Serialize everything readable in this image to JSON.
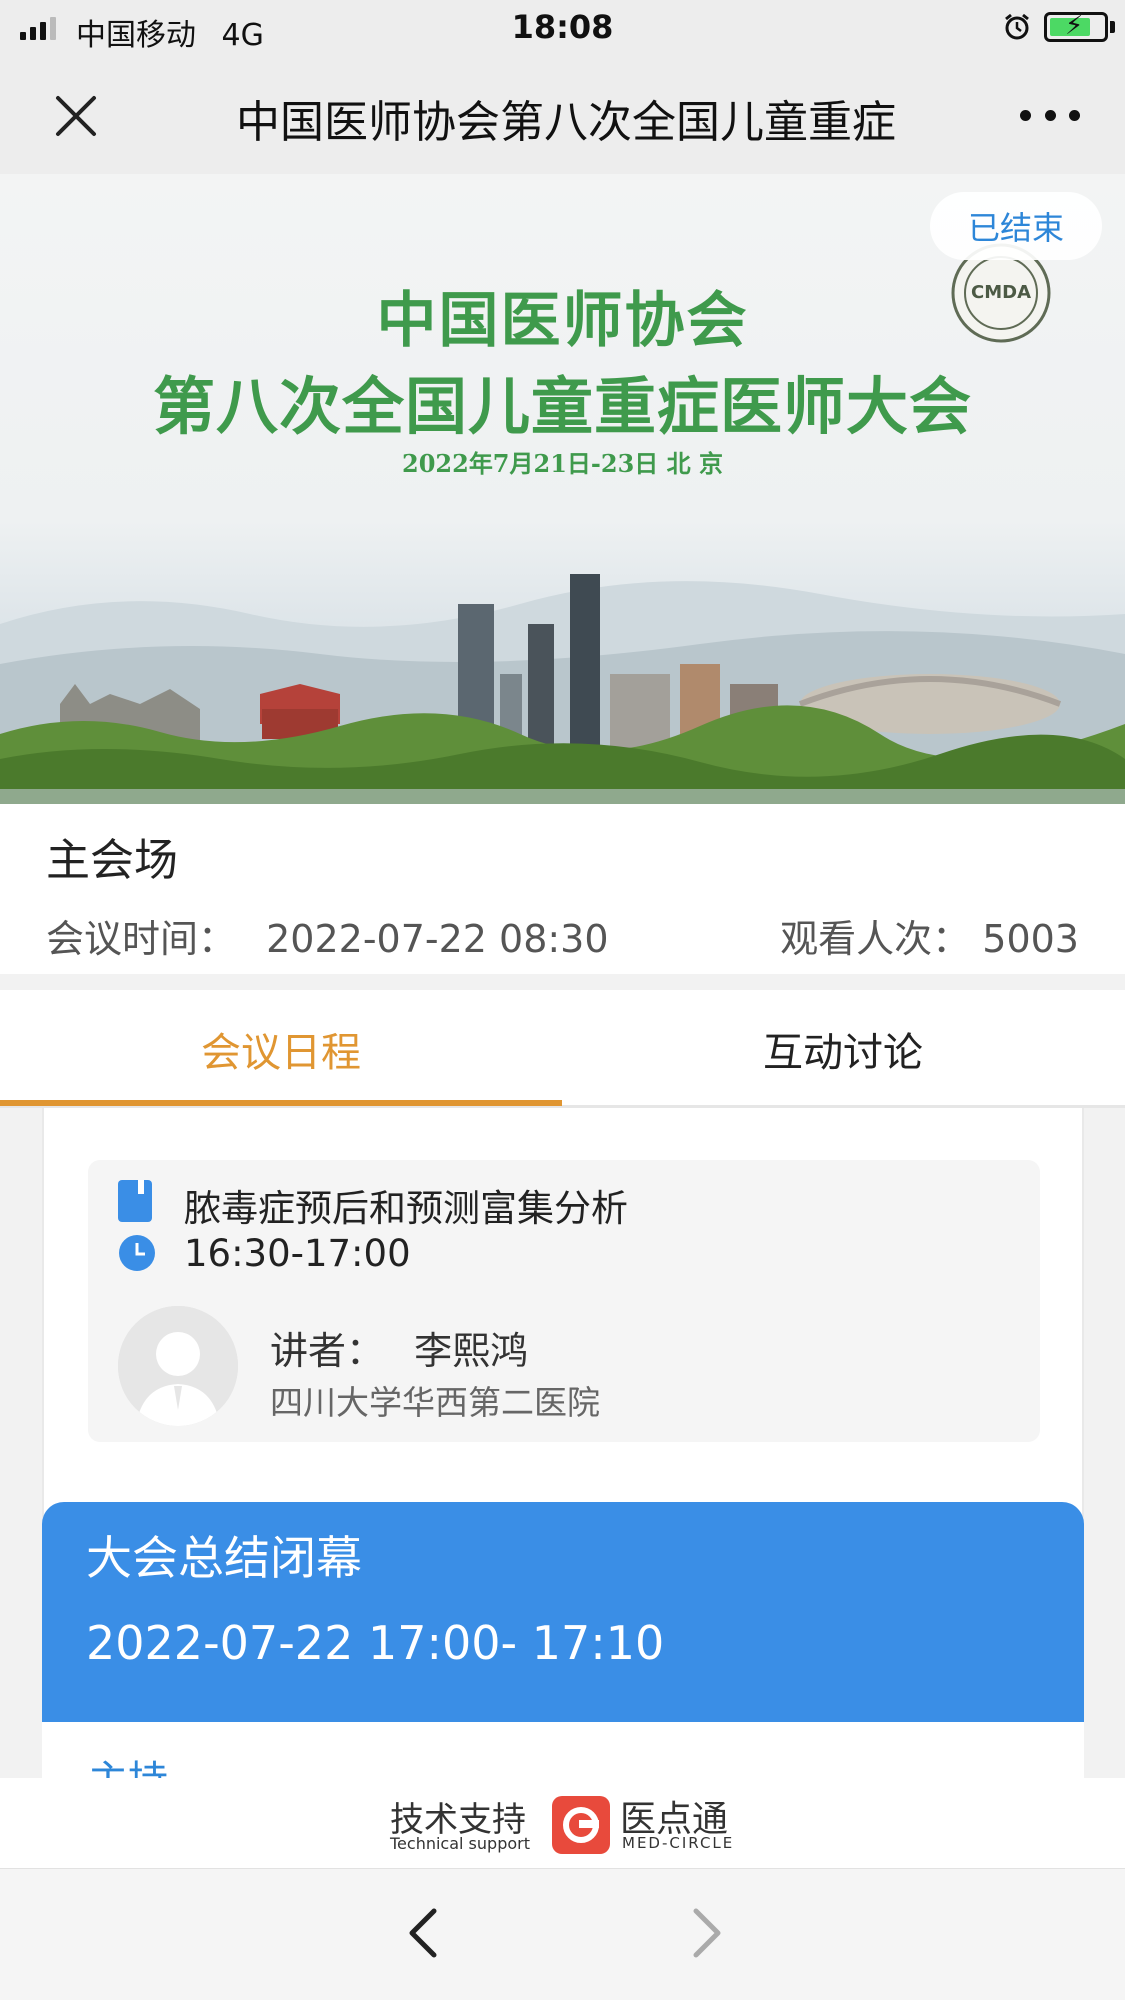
{
  "status_bar": {
    "carrier": "中国移动",
    "network": "4G",
    "time": "18:08",
    "battery_state": "charging"
  },
  "nav": {
    "title": "中国医师协会第八次全国儿童重症",
    "close_icon": "close-icon",
    "more_icon": "more-icon"
  },
  "banner": {
    "status_badge": "已结束",
    "title_line1": "中国医师协会",
    "title_line2": "第八次全国儿童重症医师大会",
    "date_location": "2022年7月21日-23日   北 京",
    "logo_text": "CMDA"
  },
  "info": {
    "hall": "主会场",
    "time_label": "会议时间：",
    "time_value": "2022-07-22 08:30",
    "views_label": "观看人次：",
    "views_value": "5003"
  },
  "tabs": [
    {
      "label": "会议日程",
      "active": true
    },
    {
      "label": "互动讨论",
      "active": false
    }
  ],
  "schedule_item": {
    "title": "脓毒症预后和预测富集分析",
    "time": "16:30-17:00",
    "speaker_label": "讲者：",
    "speaker_name": "李熙鸿",
    "hospital": "四川大学华西第二医院"
  },
  "session": {
    "title": "大会总结闭幕",
    "time": "2022-07-22 17:00- 17:10",
    "host_label": "主持"
  },
  "footer": {
    "tech_cn": "技术支持",
    "tech_en": "Technical support",
    "brand_cn": "医点通",
    "brand_en": "MED-CIRCLE"
  },
  "colors": {
    "accent_orange": "#e09632",
    "session_blue": "#3a8ee6",
    "link_blue": "#2d86d8",
    "banner_green": "#3f9a4c"
  }
}
